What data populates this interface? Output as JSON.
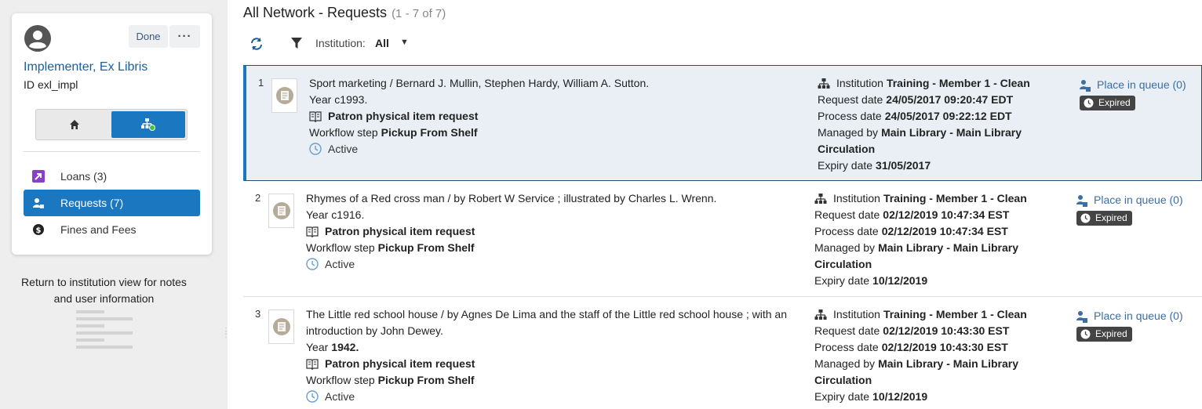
{
  "user": {
    "name": "Implementer, Ex Libris",
    "id_label": "ID",
    "id_value": "exl_impl",
    "done_label": "Done",
    "more_label": "···"
  },
  "nav": {
    "loans": "Loans (3)",
    "requests": "Requests (7)",
    "fines": "Fines and Fees"
  },
  "sidebar_note": "Return to institution view for notes and user information",
  "header": {
    "title": "All Network - Requests",
    "count": "(1 - 7 of 7)",
    "institution_label": "Institution:",
    "institution_value": "All"
  },
  "labels": {
    "year": "Year",
    "workflow": "Workflow step",
    "institution": "Institution",
    "request_date": "Request date",
    "process_date": "Process date",
    "managed_by": "Managed by",
    "expiry_date": "Expiry date"
  },
  "requests": [
    {
      "num": "1",
      "title": "Sport marketing / Bernard J. Mullin, Stephen Hardy, William A. Sutton.",
      "year": "c1993.",
      "type": "Patron physical item request",
      "workflow": "Pickup From Shelf",
      "status": "Active",
      "institution": "Training - Member 1 - Clean",
      "request_date": "24/05/2017 09:20:47 EDT",
      "process_date": "24/05/2017 09:22:12 EDT",
      "managed_by": "Main Library - Main Library Circulation",
      "expiry_date": "31/05/2017",
      "queue": "Place in queue (0)",
      "badge": "Expired"
    },
    {
      "num": "2",
      "title": "Rhymes of a Red cross man / by Robert W Service ; illustrated by Charles L. Wrenn.",
      "year": "c1916.",
      "type": "Patron physical item request",
      "workflow": "Pickup From Shelf",
      "status": "Active",
      "institution": "Training - Member 1 - Clean",
      "request_date": "02/12/2019 10:47:34 EST",
      "process_date": "02/12/2019 10:47:34 EST",
      "managed_by": "Main Library - Main Library Circulation",
      "expiry_date": "10/12/2019",
      "queue": "Place in queue (0)",
      "badge": "Expired"
    },
    {
      "num": "3",
      "title": "The Little red school house / by Agnes De Lima and the staff of the Little red school house ; with an introduction by John Dewey.",
      "year": "1942.",
      "type": "Patron physical item request",
      "workflow": "Pickup From Shelf",
      "status": "Active",
      "institution": "Training - Member 1 - Clean",
      "request_date": "02/12/2019 10:43:30 EST",
      "process_date": "02/12/2019 10:43:30 EST",
      "managed_by": "Main Library - Main Library Circulation",
      "expiry_date": "10/12/2019",
      "queue": "Place in queue (0)",
      "badge": "Expired"
    }
  ]
}
